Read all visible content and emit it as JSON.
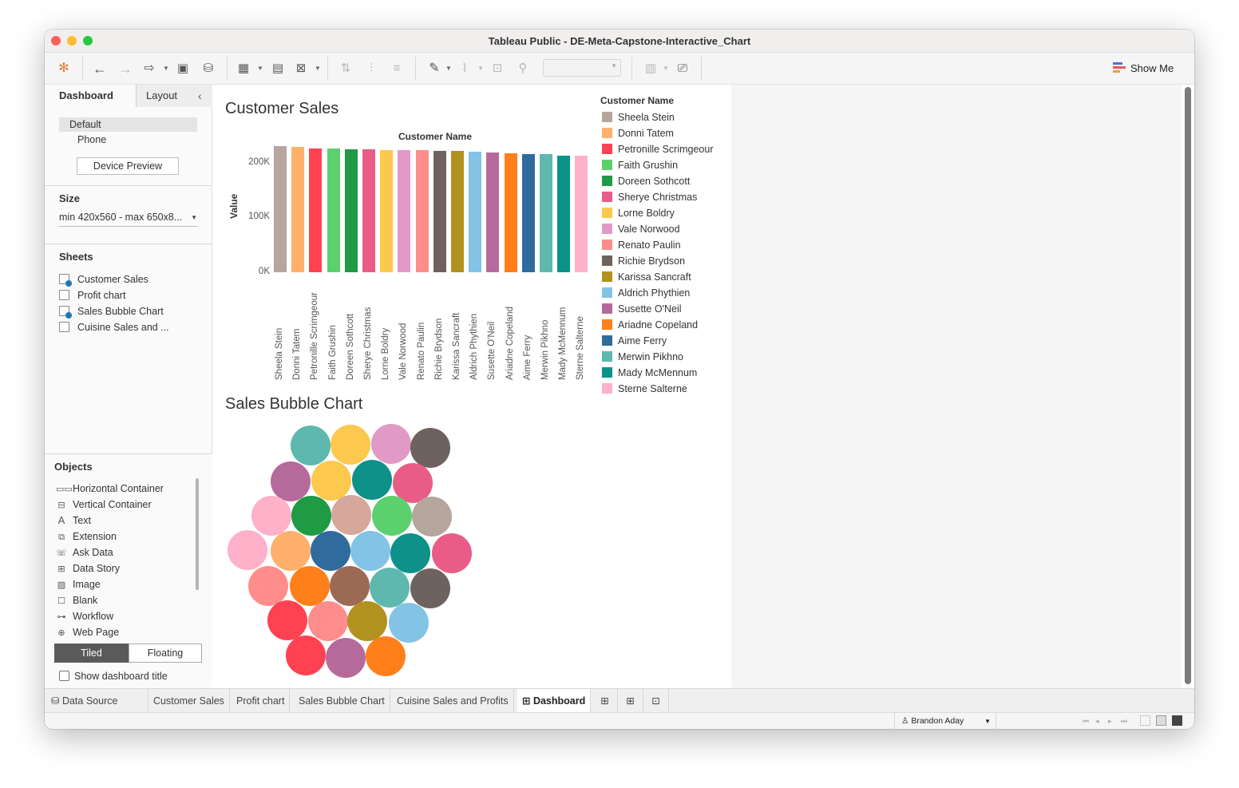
{
  "window": {
    "title": "Tableau Public - DE-Meta-Capstone-Interactive_Chart"
  },
  "toolbar": {
    "show_me_label": "Show Me"
  },
  "sidebar": {
    "tabs": {
      "dashboard": "Dashboard",
      "layout": "Layout"
    },
    "device": {
      "default": "Default",
      "phone": "Phone",
      "preview_button": "Device Preview"
    },
    "size": {
      "heading": "Size",
      "value": "min 420x560 - max 650x8..."
    },
    "sheets": {
      "heading": "Sheets",
      "items": [
        {
          "label": "Customer Sales",
          "used": true
        },
        {
          "label": "Profit chart",
          "used": false
        },
        {
          "label": "Sales Bubble Chart",
          "used": true
        },
        {
          "label": "Cuisine Sales and ...",
          "used": false
        }
      ]
    },
    "objects": {
      "heading": "Objects",
      "items": [
        {
          "label": "Horizontal Container",
          "icon": "horizontal-container-icon"
        },
        {
          "label": "Vertical Container",
          "icon": "vertical-container-icon"
        },
        {
          "label": "Text",
          "icon": "text-icon"
        },
        {
          "label": "Extension",
          "icon": "extension-icon"
        },
        {
          "label": "Ask Data",
          "icon": "ask-data-icon"
        },
        {
          "label": "Data Story",
          "icon": "data-story-icon"
        },
        {
          "label": "Image",
          "icon": "image-icon"
        },
        {
          "label": "Blank",
          "icon": "blank-icon"
        },
        {
          "label": "Workflow",
          "icon": "workflow-icon"
        },
        {
          "label": "Web Page",
          "icon": "web-page-icon"
        }
      ],
      "tiled_label": "Tiled",
      "floating_label": "Floating",
      "show_title_label": "Show dashboard title"
    }
  },
  "dashboard": {
    "customer_sales": {
      "title": "Customer Sales"
    },
    "bubble": {
      "title": "Sales Bubble Chart"
    },
    "legend": {
      "heading": "Customer Name"
    }
  },
  "customers": [
    {
      "name": "Sheela Stein",
      "color": "#b5a69e"
    },
    {
      "name": "Donni Tatem",
      "color": "#ffb06b"
    },
    {
      "name": "Petronille Scrimgeour",
      "color": "#ff4252"
    },
    {
      "name": "Faith Grushin",
      "color": "#5cd06d"
    },
    {
      "name": "Doreen Sothcott",
      "color": "#1f9a45"
    },
    {
      "name": "Sherye Christmas",
      "color": "#ea5c88"
    },
    {
      "name": "Lorne Boldry",
      "color": "#fcc84d"
    },
    {
      "name": "Vale Norwood",
      "color": "#e09ac5"
    },
    {
      "name": "Renato Paulin",
      "color": "#ff8d8c"
    },
    {
      "name": "Richie Brydson",
      "color": "#6e625e"
    },
    {
      "name": "Karissa Sancraft",
      "color": "#b2921e"
    },
    {
      "name": "Aldrich Phythien",
      "color": "#82c3e6"
    },
    {
      "name": "Susette O'Neil",
      "color": "#b66a9c"
    },
    {
      "name": "Ariadne Copeland",
      "color": "#ff7f1a"
    },
    {
      "name": "Aime Ferry",
      "color": "#2f6b9c"
    },
    {
      "name": "Merwin Pikhno",
      "color": "#5eb8ad"
    },
    {
      "name": "Mady McMennum",
      "color": "#0e9189"
    },
    {
      "name": "Sterne Salterne",
      "color": "#feb1c9"
    }
  ],
  "chart_data": [
    {
      "type": "bar",
      "title": "Customer Sales",
      "xlabel": "Customer Name",
      "ylabel": "Value",
      "ylim": [
        0,
        240000
      ],
      "yticks": [
        "0K",
        "100K",
        "200K"
      ],
      "categories": [
        "Sheela Stein",
        "Donni Tatem",
        "Petronille Scrimgeour",
        "Faith Grushin",
        "Doreen Sothcott",
        "Sherye Christmas",
        "Lorne Boldry",
        "Vale Norwood",
        "Renato Paulin",
        "Richie Brydson",
        "Karissa Sancraft",
        "Aldrich Phythien",
        "Susette O'Neil",
        "Ariadne Copeland",
        "Aime Ferry",
        "Merwin Pikhno",
        "Mady McMennum",
        "Sterne Salterne"
      ],
      "values": [
        230000,
        229000,
        226000,
        225000,
        224000,
        224000,
        223000,
        223000,
        222000,
        221000,
        221000,
        219000,
        218000,
        217000,
        216000,
        215000,
        213000,
        212000
      ],
      "legend": "right"
    },
    {
      "type": "bubble",
      "title": "Sales Bubble Chart",
      "values": [
        230000,
        229000,
        226000,
        225000,
        224000,
        224000,
        223000,
        223000,
        222000,
        221000,
        221000,
        219000,
        218000,
        217000,
        216000,
        215000,
        213000,
        212000
      ]
    }
  ],
  "sheet_tabs": {
    "data_source": "Data Source",
    "items": [
      "Customer Sales",
      "Profit chart",
      "Sales Bubble Chart",
      "Cuisine Sales and Profits",
      "Dashboard"
    ]
  },
  "status": {
    "user": "Brandon Aday"
  }
}
